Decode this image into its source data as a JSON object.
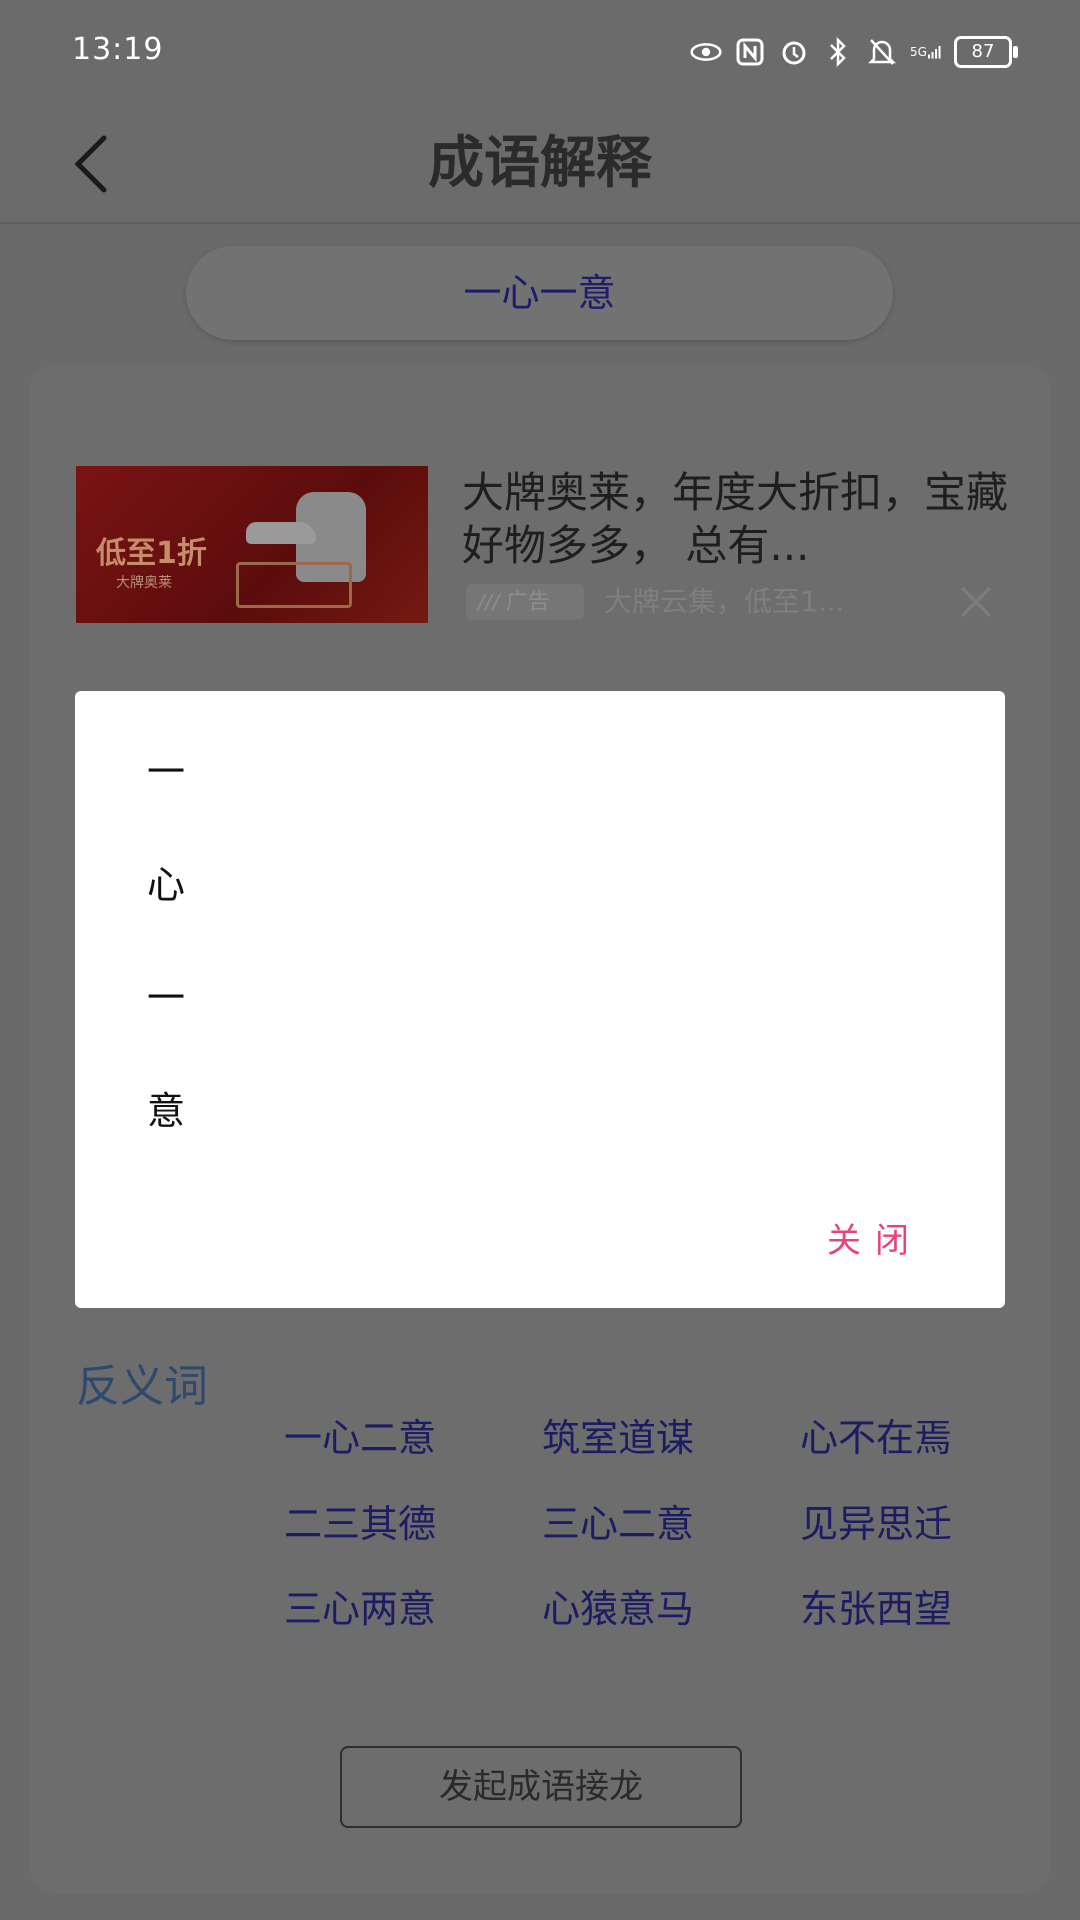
{
  "status_bar": {
    "time": "13:19",
    "network": "5G",
    "battery": "87"
  },
  "header": {
    "title": "成语解释"
  },
  "idiom": "一心一意",
  "ad": {
    "image_promo": "低至1折",
    "image_brand": "大牌奥莱",
    "title": "大牌奥莱，年度大折扣，宝藏好物多多， 总有...",
    "badge": "广告",
    "subtitle": "大牌云集，低至1..."
  },
  "antonyms": {
    "label": "反义词",
    "words": [
      "一心二意",
      "筑室道谋",
      "心不在焉",
      "二三其德",
      "三心二意",
      "见异思迁",
      "三心两意",
      "心猿意马",
      "东张西望"
    ]
  },
  "jielong_button": "发起成语接龙",
  "dialog": {
    "chars": [
      "一",
      "心",
      "一",
      "意"
    ],
    "close_label": "关闭"
  }
}
